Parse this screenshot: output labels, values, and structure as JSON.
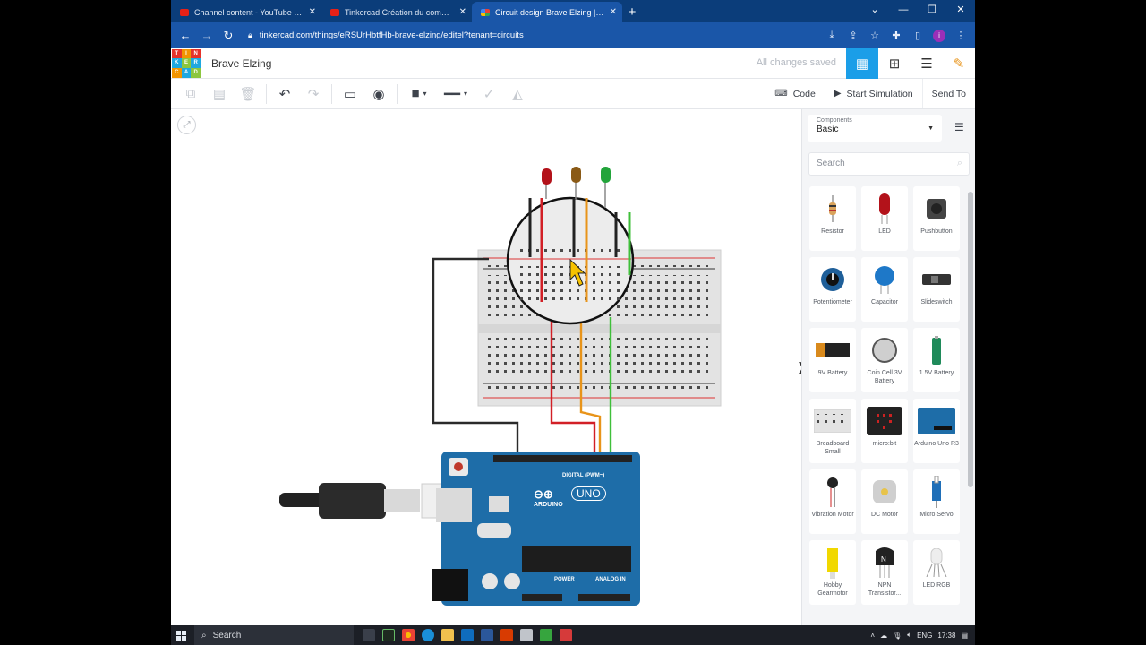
{
  "browser": {
    "tabs": [
      {
        "label": "Channel content - YouTube Studio",
        "favicon": "youtube-icon",
        "active": false
      },
      {
        "label": "Tinkercad Création du compte -",
        "favicon": "youtube-icon",
        "active": false
      },
      {
        "label": "Circuit design Brave Elzing | Tinkercad",
        "favicon": "tinkercad-icon",
        "active": true
      }
    ],
    "new_tab": "+",
    "url": "tinkercad.com/things/eRSUrHbtfHb-brave-elzing/editel?tenant=circuits"
  },
  "header": {
    "logo_letters": [
      "TIN",
      "KER",
      "CAD"
    ],
    "project_title": "Brave Elzing",
    "save_status": "All changes saved"
  },
  "toolbar": {
    "code_label": "Code",
    "simulate_label": "Start Simulation",
    "send_label": "Send To"
  },
  "panel": {
    "components_label": "Components",
    "category": "Basic",
    "search_placeholder": "Search",
    "items": [
      {
        "name": "Resistor",
        "icon": "resistor-icon"
      },
      {
        "name": "LED",
        "icon": "led-icon"
      },
      {
        "name": "Pushbutton",
        "icon": "pushbutton-icon"
      },
      {
        "name": "Potentiometer",
        "icon": "potentiometer-icon"
      },
      {
        "name": "Capacitor",
        "icon": "capacitor-icon"
      },
      {
        "name": "Slideswitch",
        "icon": "slideswitch-icon"
      },
      {
        "name": "9V Battery",
        "icon": "battery-9v-icon"
      },
      {
        "name": "Coin Cell 3V Battery",
        "icon": "coin-cell-icon"
      },
      {
        "name": "1.5V Battery",
        "icon": "battery-aa-icon"
      },
      {
        "name": "Breadboard Small",
        "icon": "breadboard-icon"
      },
      {
        "name": "micro:bit",
        "icon": "microbit-icon"
      },
      {
        "name": "Arduino Uno R3",
        "icon": "arduino-icon"
      },
      {
        "name": "Vibration Motor",
        "icon": "vibration-motor-icon"
      },
      {
        "name": "DC Motor",
        "icon": "dc-motor-icon"
      },
      {
        "name": "Micro Servo",
        "icon": "micro-servo-icon"
      },
      {
        "name": "Hobby Gearmotor",
        "icon": "gearmotor-icon"
      },
      {
        "name": "NPN Transistor...",
        "icon": "npn-transistor-icon"
      },
      {
        "name": "LED RGB",
        "icon": "led-rgb-icon"
      }
    ]
  },
  "canvas": {
    "arduino_brand": "ARDUINO",
    "arduino_model": "UNO",
    "digital_label": "DIGITAL (PWM~)",
    "analog_label": "ANALOG IN",
    "power_label": "POWER",
    "led_colors": [
      "#b3121a",
      "#8a5a16",
      "#22a43a"
    ],
    "wire_colors": {
      "red": "#d21f26",
      "orange": "#e8941a",
      "green": "#3fbf3a",
      "black": "#2a2a2a"
    }
  },
  "taskbar": {
    "search_label": "Search",
    "language": "ENG",
    "time": "17:38"
  }
}
